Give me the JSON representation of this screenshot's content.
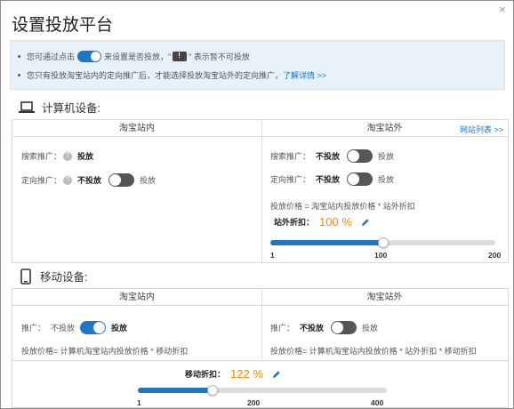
{
  "dialog": {
    "title": "设置投放平台",
    "close_glyph": "×"
  },
  "notice": {
    "line1_prefix": "您可通过点击",
    "line1_middle": "来设置是否投放，\"",
    "line1_suffix": "\" 表示暂不可投放",
    "line2_text": "您只有投放淘宝站内的定向推广后，才能选择投放淘宝站外的定向推广，",
    "line2_link": "了解详情 >>"
  },
  "pc": {
    "heading": "计算机设备:",
    "col_inside": "淘宝站内",
    "col_outside": "淘宝站外",
    "site_list_link": "网站列表 >>",
    "inside": {
      "search_label": "搜索推广：",
      "search_value": "投放",
      "target_label": "定向推广：",
      "target_off": "不投放",
      "target_on": "投放"
    },
    "outside": {
      "search_label": "搜索推广：",
      "search_off": "不投放",
      "search_on": "投放",
      "target_label": "定向推广：",
      "target_off": "不投放",
      "target_on": "投放",
      "price_formula": "投放价格 = 淘宝站内投放价格 * 站外折扣",
      "discount_label": "站外折扣：",
      "discount_value": "100 %",
      "slider_ticks": [
        "1",
        "100",
        "200"
      ],
      "slider_level": 0.5
    }
  },
  "mobile": {
    "heading": "移动设备:",
    "col_inside": "淘宝站内",
    "col_outside": "淘宝站外",
    "inside": {
      "promo_label": "推广：",
      "promo_off": "不投放",
      "promo_on": "投放",
      "price_formula": "投放价格= 计算机淘宝站内投放价格 * 移动折扣"
    },
    "outside": {
      "promo_label": "推广：",
      "promo_off": "不投放",
      "promo_on": "投放",
      "price_formula": "投放价格= 计算机淘宝站内投放价格 * 站外折扣 * 移动折扣"
    },
    "discount_label": "移动折扣：",
    "discount_value": "122 %",
    "slider_ticks": [
      "1",
      "200",
      "400"
    ],
    "slider_level": 0.3
  },
  "colors": {
    "accent": "#1f76c4",
    "toggle_off": "#565656",
    "highlight": "#f08c00",
    "notice_bg": "#e8f1f9"
  },
  "icons": {
    "laptop": "laptop-icon",
    "phone": "mobile-phone-icon",
    "pencil": "pencil-icon",
    "help": "help-icon",
    "warning": "warning-icon"
  }
}
